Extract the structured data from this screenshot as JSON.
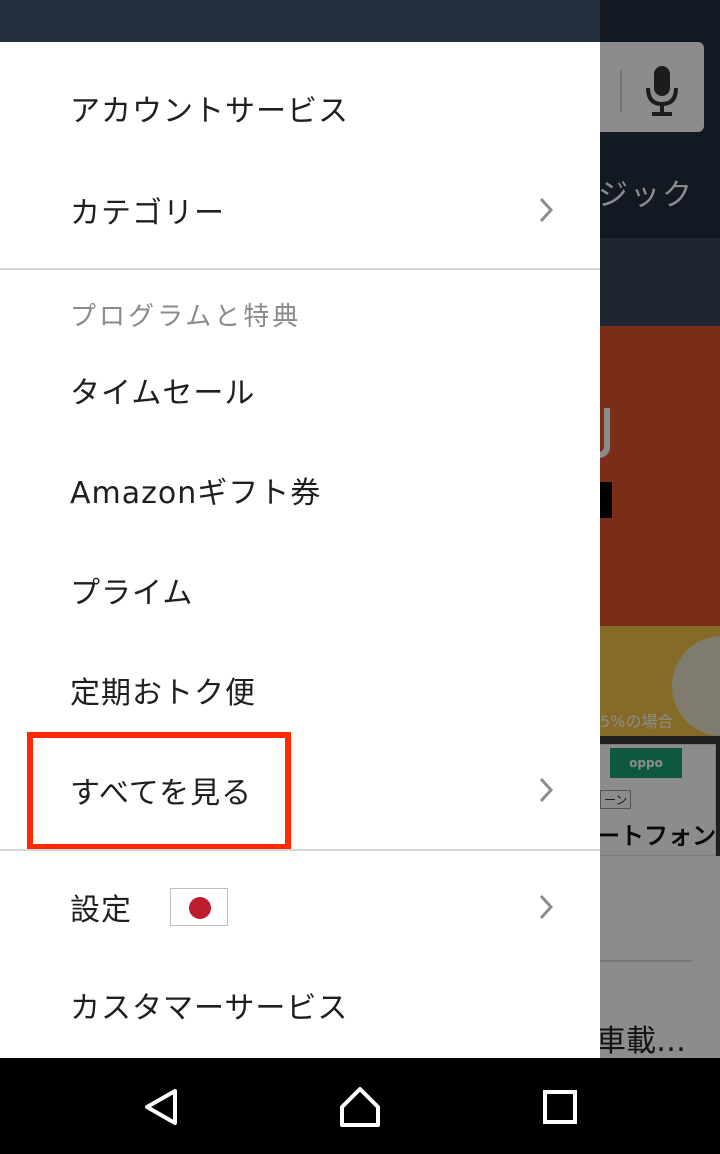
{
  "background_app": {
    "nav_text_fragment": "ジック",
    "promo_text_fragment": "5%の場合",
    "card_logo": "oppo",
    "card_badge": "ーン",
    "card_text_fragment": "ートフォン",
    "bottom_text_fragment": "車載…"
  },
  "drawer": {
    "items_top": [
      {
        "label": "アカウントサービス"
      },
      {
        "label": "カテゴリー"
      }
    ],
    "section_header": "プログラムと特典",
    "program_items": [
      {
        "label": "タイムセール"
      },
      {
        "label": "Amazonギフト券"
      },
      {
        "label": "プライム"
      },
      {
        "label": "定期おトク便"
      },
      {
        "label": "すべてを見る"
      }
    ],
    "settings_label": "設定",
    "settings_flag": "japan-flag-icon",
    "customer_service_label": "カスタマーサービス"
  },
  "navbar": {
    "icons": [
      "back-icon",
      "home-icon",
      "recents-icon"
    ]
  },
  "colors": {
    "header": "#232f3e",
    "highlight": "#ff2a00",
    "flag_red": "#bc1e2d"
  }
}
